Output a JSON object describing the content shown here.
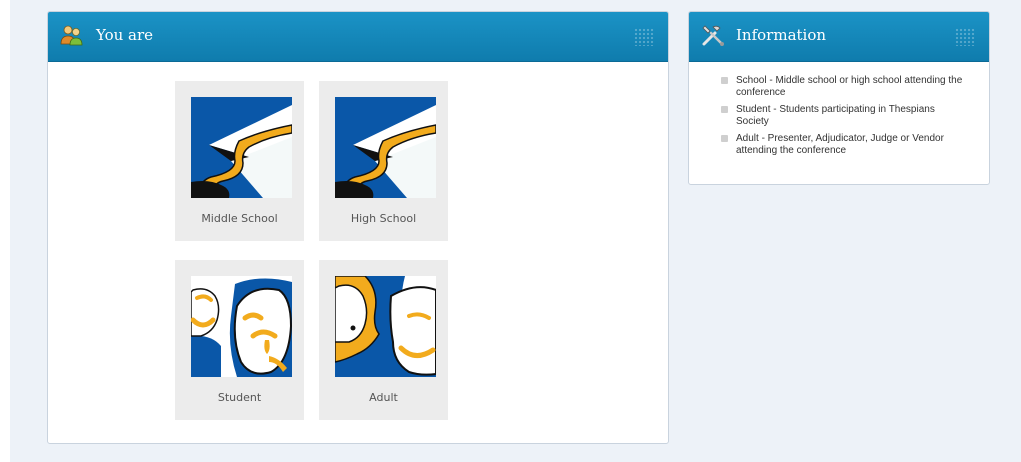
{
  "left_panel": {
    "title": "You are",
    "header_icon": "users-icon",
    "options": [
      {
        "label": "Middle School",
        "icon": "graduation-cap-icon"
      },
      {
        "label": "High School",
        "icon": "graduation-cap-icon"
      },
      {
        "label": "Student",
        "icon": "theater-masks-icon"
      },
      {
        "label": "Adult",
        "icon": "theater-mask-profile-icon"
      }
    ]
  },
  "right_panel": {
    "title": "Information",
    "header_icon": "tools-icon",
    "items": [
      {
        "text": "School - Middle school or high school attending the conference"
      },
      {
        "text": "Student - Students participating in Thespians Society"
      },
      {
        "text": "Adult - Presenter, Adjudicator, Judge or Vendor attending the conference"
      }
    ]
  },
  "colors": {
    "header_blue": "#1189bd",
    "page_background": "#edf2f8",
    "tile_background": "#ececec",
    "artwork_blue": "#0a57a8",
    "artwork_gold": "#f2ab1d"
  }
}
